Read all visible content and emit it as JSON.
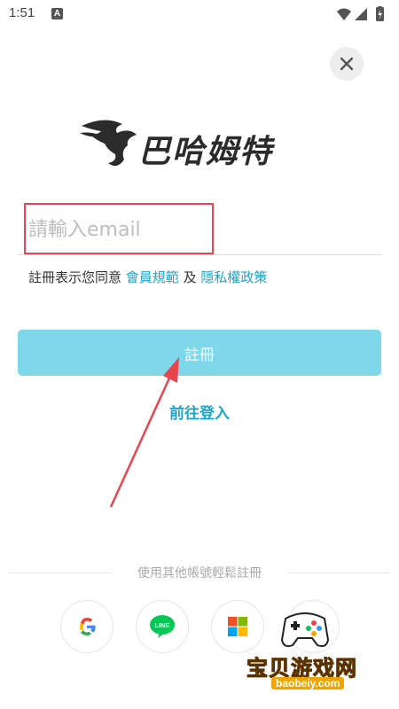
{
  "status_bar": {
    "time": "1:51",
    "notification_letter": "A"
  },
  "logo": {
    "text": "巴哈姆特"
  },
  "form": {
    "email_placeholder": "請輸入email",
    "terms_prefix": "註冊表示您同意",
    "terms_link": "會員規範",
    "terms_and": "及",
    "privacy_link": "隱私權政策",
    "register_label": "註冊",
    "login_link": "前往登入"
  },
  "social": {
    "divider_text": "使用其他帳號輕鬆註冊",
    "line_label": "LINE"
  },
  "watermark": {
    "title": "宝贝游戏网",
    "url": "baobeiy.com"
  },
  "colors": {
    "accent": "#1ea5c5",
    "register_button": "#7fd7ea",
    "annotation_red": "#e8454e"
  }
}
